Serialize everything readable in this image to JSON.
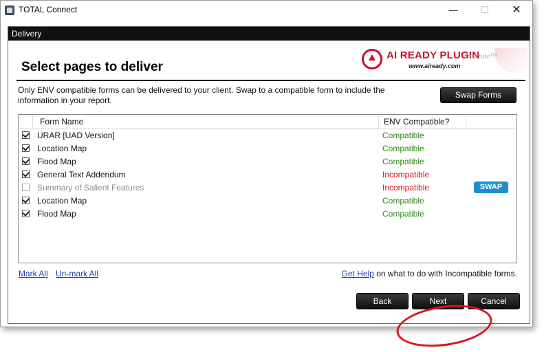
{
  "window": {
    "title": "TOTAL Connect"
  },
  "dialog": {
    "header": "Delivery",
    "title": "Select pages to deliver",
    "logo": {
      "plugin_text": "AI READY PLUGIN",
      "url_text": "www.aiready.com",
      "institute_text": "Institute™"
    },
    "info_text": "Only ENV compatible forms can be delivered to your client. Swap to a compatible form to include the information in your report.",
    "swap_forms_label": "Swap Forms",
    "table": {
      "columns": [
        "Form Name",
        "ENV Compatible?"
      ],
      "rows": [
        {
          "name": "URAR [UAD Version]",
          "status": "Compatible",
          "checked": true
        },
        {
          "name": "Location Map",
          "status": "Compatible",
          "checked": true
        },
        {
          "name": "Flood Map",
          "status": "Compatible",
          "checked": true
        },
        {
          "name": "General Text Addendum",
          "status": "Incompatible",
          "checked": true
        },
        {
          "name": "Summary of Salient Features",
          "status": "Incompatible",
          "checked": false,
          "swap_label": "SWAP"
        },
        {
          "name": "Location Map",
          "status": "Compatible",
          "checked": true
        },
        {
          "name": "Flood Map",
          "status": "Compatible",
          "checked": true
        }
      ]
    },
    "links": {
      "mark_all": "Mark All",
      "unmark_all": "Un-mark All",
      "get_help": "Get Help",
      "help_suffix": " on what to do with Incompatible forms."
    },
    "buttons": {
      "back": "Back",
      "next": "Next",
      "cancel": "Cancel"
    }
  },
  "colors": {
    "compatible": "#2e8b1e",
    "incompatible": "#d4101c",
    "swap": "#1a8fd0",
    "brand_red": "#c8102e"
  }
}
